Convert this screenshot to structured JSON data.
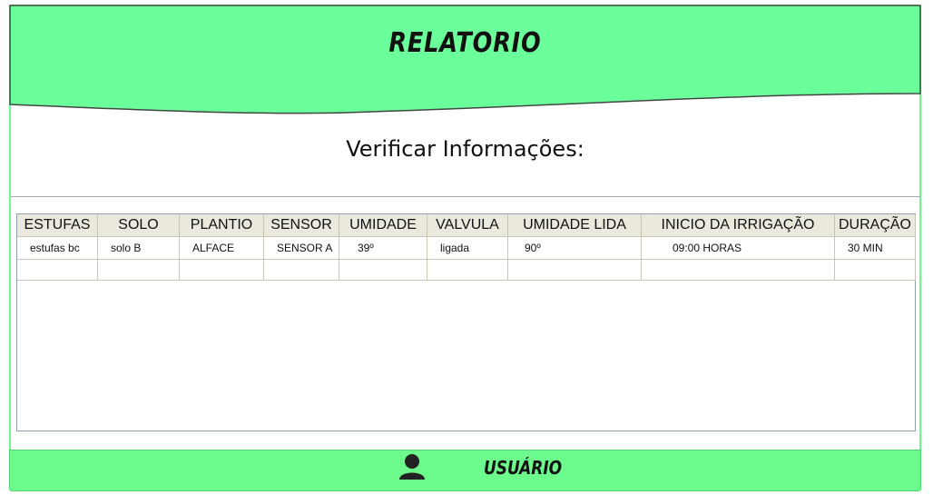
{
  "header": {
    "title": "RELATORIO"
  },
  "section": {
    "subtitle": "Verificar Informações:"
  },
  "table": {
    "columns": [
      "ESTUFAS",
      "SOLO",
      "PLANTIO",
      "SENSOR",
      "UMIDADE",
      "VALVULA",
      "UMIDADE LIDA",
      "INICIO DA IRRIGAÇÃO",
      "DURAÇÃO"
    ],
    "rows": [
      [
        "estufas bc",
        "solo B",
        "ALFACE",
        "SENSOR A",
        "39º",
        "ligada",
        "90º",
        "09:00 HORAS",
        "30 MIN"
      ]
    ]
  },
  "footer": {
    "user_label": "USUÁRIO",
    "user_icon": "user-icon"
  },
  "colors": {
    "accent": "#6cfa8c",
    "header_fill": "#6aff9a",
    "grid_header": "#ebe9dd"
  }
}
